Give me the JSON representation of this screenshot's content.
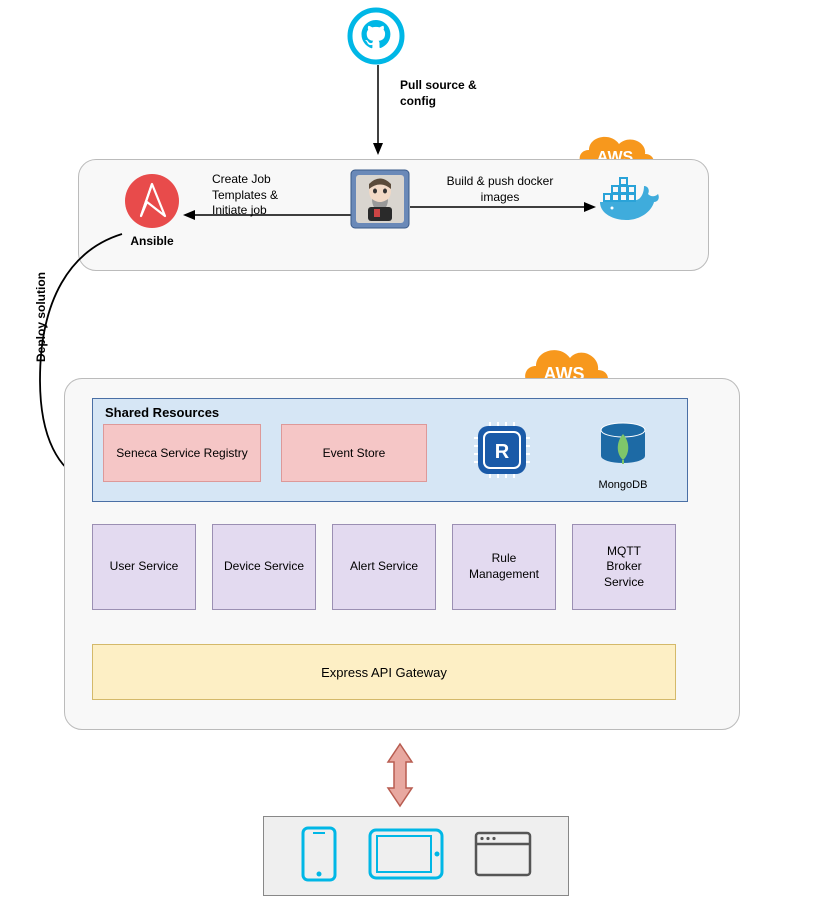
{
  "top": {
    "github_icon": "github-icon",
    "pull_label": "Pull source &\nconfig"
  },
  "ci": {
    "ansible_label": "Ansible",
    "create_label": "Create Job\nTemplates &\nInitiate job",
    "build_label": "Build & push docker\nimages",
    "jenkins_icon": "jenkins-icon",
    "docker_icon": "docker-icon",
    "aws_label": "AWS"
  },
  "deploy_label": "Deploy solution",
  "arch": {
    "aws_label": "AWS",
    "shared_title": "Shared Resources",
    "registry": "Seneca Service Registry",
    "event_store": "Event Store",
    "redis_icon": "redis-icon",
    "mongodb_label": "MongoDB",
    "services": [
      "User Service",
      "Device Service",
      "Alert Service",
      "Rule\nManagement",
      "MQTT\nBroker\nService"
    ],
    "gateway": "Express API Gateway"
  },
  "clients": {
    "phone": "phone-icon",
    "tablet": "tablet-icon",
    "browser": "browser-icon"
  }
}
